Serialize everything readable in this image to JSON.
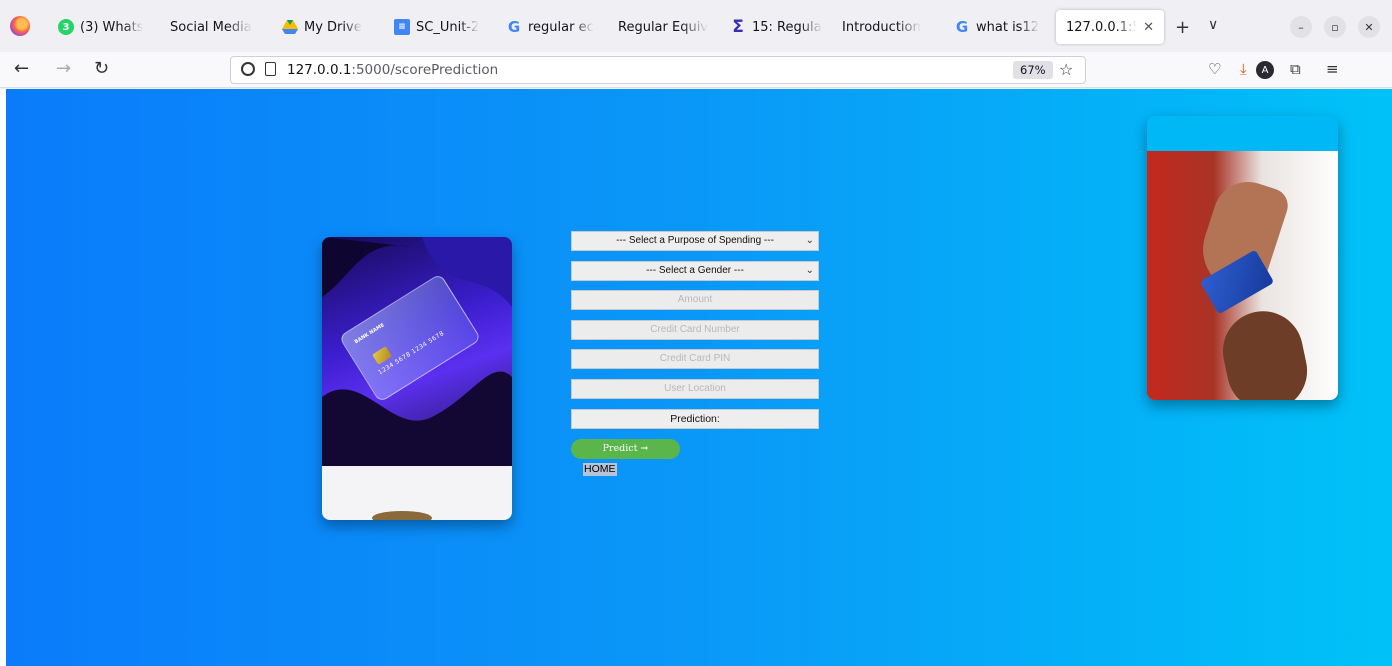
{
  "browser": {
    "tabs": [
      {
        "label": "(3) Whats",
        "icon": "whatsapp-icon",
        "badge": "3"
      },
      {
        "label": "Social Media",
        "icon": "none"
      },
      {
        "label": "My Drive",
        "icon": "google-drive-icon"
      },
      {
        "label": "SC_Unit-2",
        "icon": "google-docs-icon"
      },
      {
        "label": "regular ec",
        "icon": "google-icon"
      },
      {
        "label": "Regular Equiv",
        "icon": "none"
      },
      {
        "label": "15: Regula",
        "icon": "sigma-icon"
      },
      {
        "label": "Introduction",
        "icon": "none"
      },
      {
        "label": "what is12",
        "icon": "google-icon"
      },
      {
        "label": "127.0.0.1:5",
        "icon": "none",
        "active": true
      }
    ],
    "new_tab_glyph": "+",
    "tab_list_glyph": "∨",
    "url_host": "127.0.0.1",
    "url_path": ":5000/scorePrediction",
    "zoom": "67%"
  },
  "form": {
    "purpose_select": "--- Select a Purpose of Spending ---",
    "gender_select": "--- Select a Gender ---",
    "amount_placeholder": "Amount",
    "card_number_placeholder": "Credit Card Number",
    "card_pin_placeholder": "Credit Card PIN",
    "location_placeholder": "User Location",
    "prediction_label": "Prediction:",
    "predict_button": "Predict ➞",
    "home_link": "HOME"
  },
  "card_image": {
    "bank_name": "BANK NAME",
    "card_number": "1234 5678 1234 5678"
  },
  "colors": {
    "page_gradient_start": "#0a7cfa",
    "page_gradient_end": "#00c2f8",
    "predict_button": "#5ab54a"
  }
}
